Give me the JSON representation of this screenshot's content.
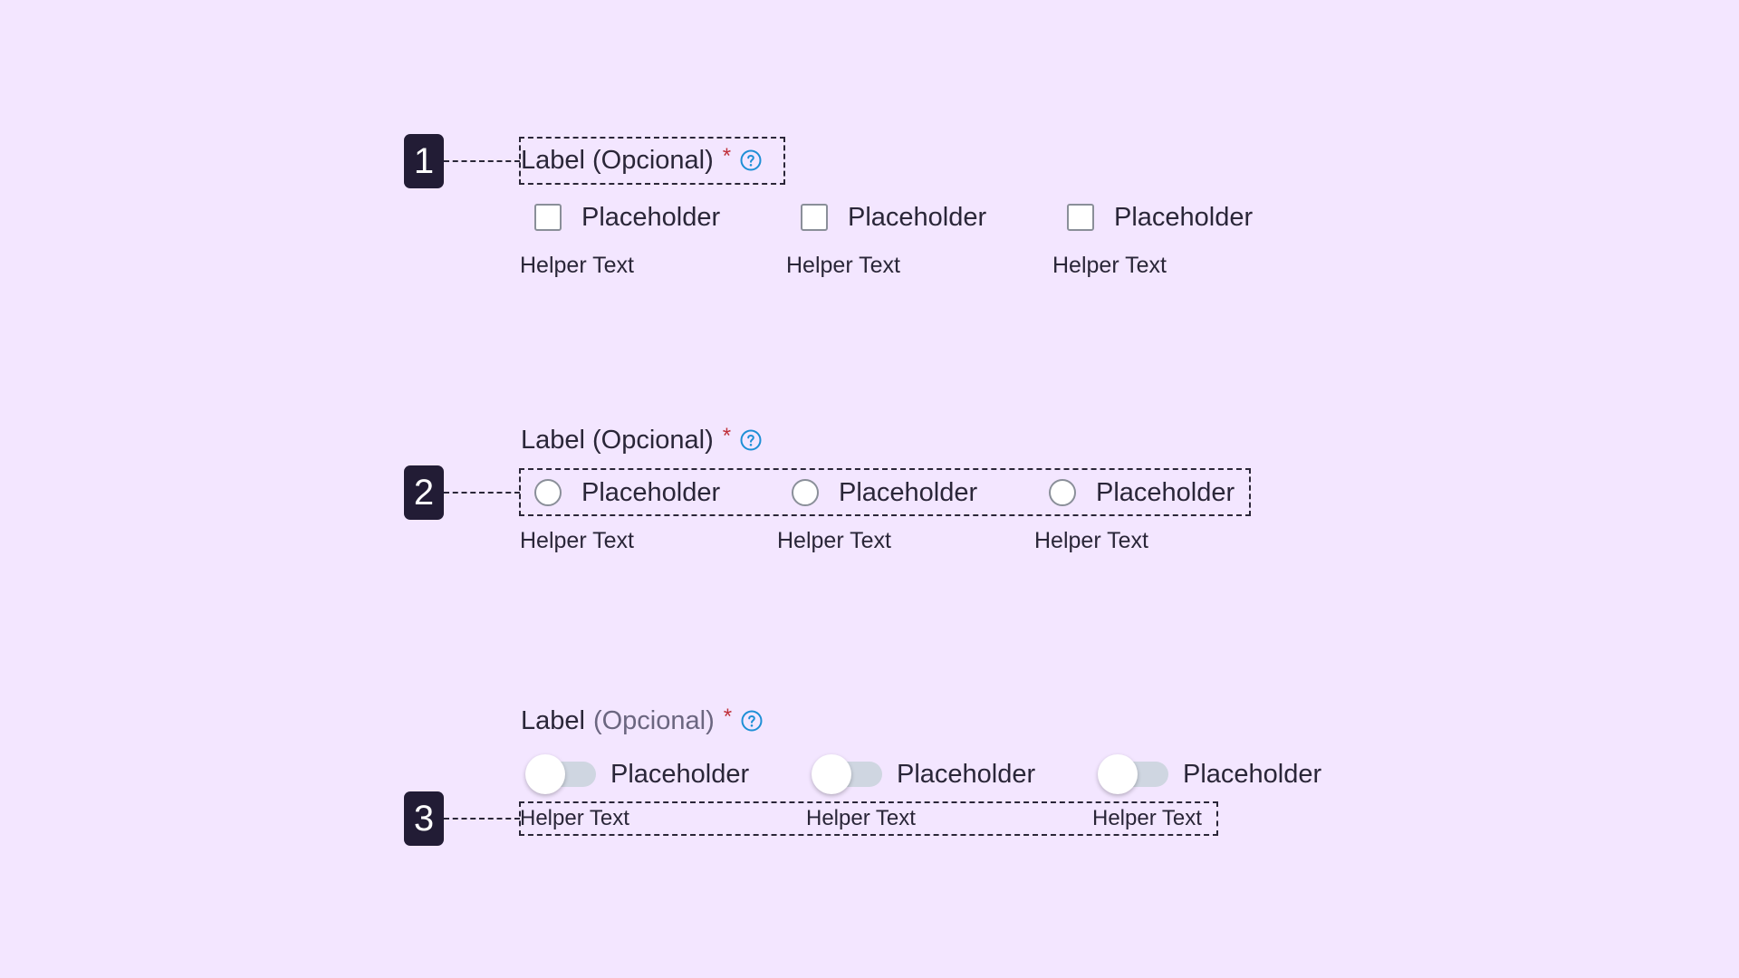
{
  "badges": [
    "1",
    "2",
    "3"
  ],
  "section1": {
    "label": "Label (Opcional)",
    "required_mark": "*",
    "options": [
      "Placeholder",
      "Placeholder",
      "Placeholder"
    ],
    "helpers": [
      "Helper Text",
      "Helper Text",
      "Helper Text"
    ]
  },
  "section2": {
    "label": "Label (Opcional)",
    "required_mark": "*",
    "options": [
      "Placeholder",
      "Placeholder",
      "Placeholder"
    ],
    "helpers": [
      "Helper Text",
      "Helper Text",
      "Helper Text"
    ]
  },
  "section3": {
    "label_main": "Label",
    "label_optional": "(Opcional)",
    "required_mark": "*",
    "options": [
      "Placeholder",
      "Placeholder",
      "Placeholder"
    ],
    "helpers": [
      "Helper Text",
      "Helper Text",
      "Helper Text"
    ]
  },
  "icons": {
    "help": "question-circle-icon",
    "checkbox": "checkbox-unchecked-icon",
    "radio": "radio-unchecked-icon",
    "toggle": "toggle-off-icon"
  },
  "colors": {
    "background": "#f3e6ff",
    "badge": "#221c35",
    "required": "#c0303a",
    "help_icon": "#1e8fd6",
    "toggle_track": "#cfd6e1"
  }
}
